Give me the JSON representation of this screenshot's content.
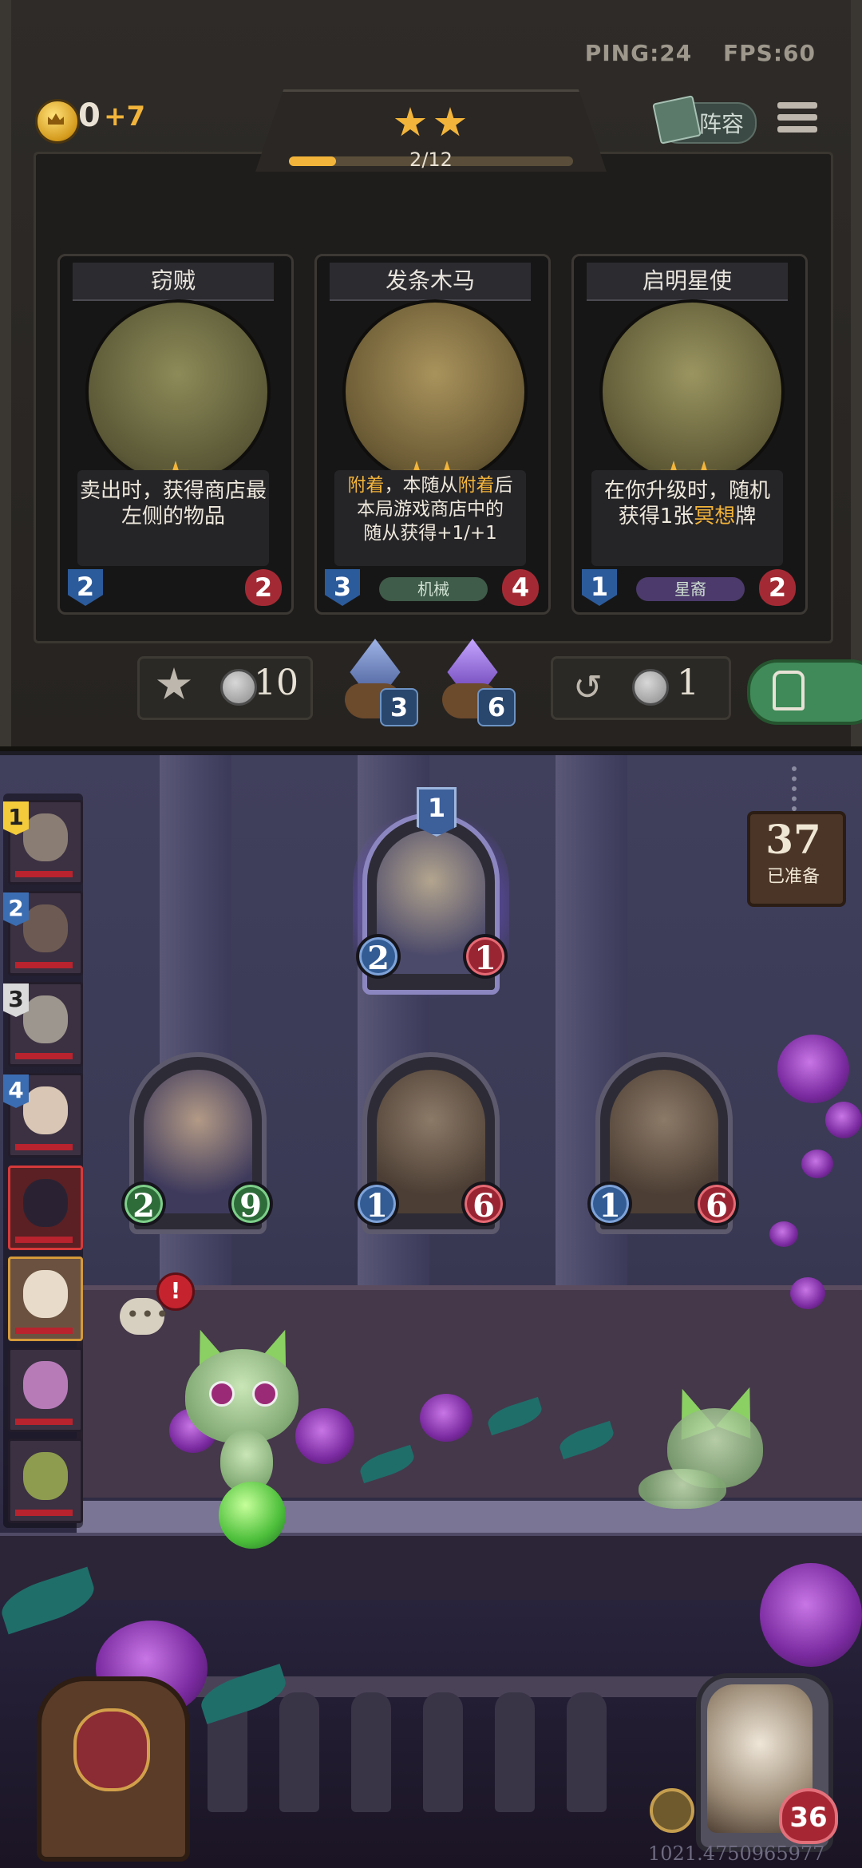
{
  "hud": {
    "ping": "PING:24",
    "fps": "FPS:60"
  },
  "player": {
    "gold": "0",
    "gold_income": "+7"
  },
  "tier": {
    "stars": 2,
    "xp_text": "2/12",
    "xp_fraction": 0.167
  },
  "header": {
    "lineup_label": "阵容"
  },
  "shop": {
    "cards": [
      {
        "name": "窃贼",
        "stars": 1,
        "desc_lines": [
          "卖出时，获得商店最",
          "左侧的物品"
        ],
        "tag": "",
        "attack": "2",
        "health": "2"
      },
      {
        "name": "发条木马",
        "stars": 2,
        "desc_lines": [
          "附着，本随从附着后",
          "本局游戏商店中的",
          "随从获得+1/+1"
        ],
        "tag": "机械",
        "attack": "3",
        "health": "4"
      },
      {
        "name": "启明星使",
        "stars": 2,
        "desc_lines": [
          "在你升级时，随机",
          "获得1张冥想牌"
        ],
        "tag": "星裔",
        "attack": "1",
        "health": "2"
      }
    ],
    "upgrade_cost": "10",
    "gem_bag_blue": "3",
    "gem_bag_purple": "6",
    "refresh_cost": "1"
  },
  "board": {
    "featured_level": "1",
    "featured_unit": {
      "attack": "2",
      "health": "1"
    },
    "units": [
      {
        "attack": "2",
        "health": "9"
      },
      {
        "attack": "1",
        "health": "6"
      },
      {
        "attack": "1",
        "health": "6"
      }
    ],
    "ready_count": "37",
    "ready_label": "已准备",
    "chat_alert": "!"
  },
  "roster": {
    "ranks": [
      "1",
      "2",
      "3",
      "4"
    ]
  },
  "hero": {
    "health": "36"
  },
  "footer": {
    "game_id": "1021.4750965977"
  },
  "colors": {
    "gold": "#f2b43a",
    "attack_blue": "#335c94",
    "health_red": "#992533",
    "lock_green": "#3f8a58"
  }
}
